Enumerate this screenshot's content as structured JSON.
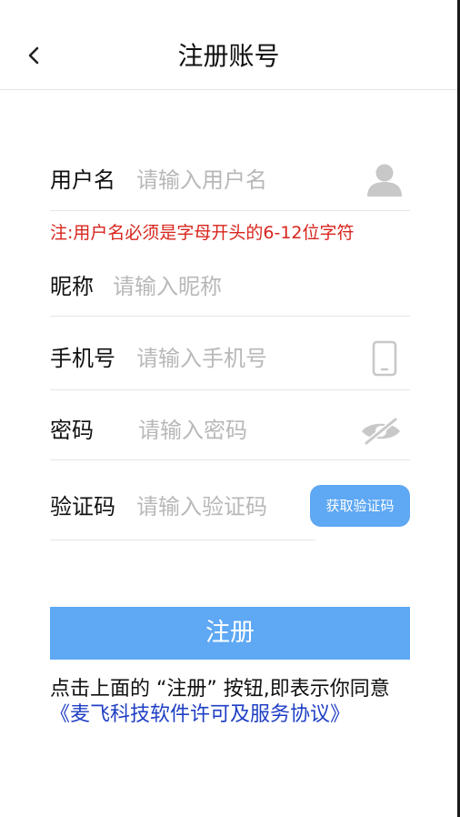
{
  "header": {
    "title": "注册账号",
    "back_icon": "chevron-left-icon"
  },
  "form": {
    "username": {
      "label": "用户名",
      "placeholder": "请输入用户名",
      "icon": "user-icon"
    },
    "username_hint": "注:用户名必须是字母开头的6-12位字符",
    "nickname": {
      "label": "昵称",
      "placeholder": "请输入昵称"
    },
    "phone": {
      "label": "手机号",
      "placeholder": "请输入手机号",
      "icon": "phone-icon"
    },
    "password": {
      "label": "密码",
      "placeholder": "请输入密码",
      "icon": "eye-off-icon"
    },
    "verification": {
      "label": "验证码",
      "placeholder": "请输入验证码",
      "button_label": "获取验证码"
    }
  },
  "submit_label": "注册",
  "agreement": {
    "text": "点击上面的 “注册” 按钮,即表示你同意",
    "link": "《麦飞科技软件许可及服务协议》"
  },
  "colors": {
    "primary": "#5ea8f4",
    "hint": "#d8251d",
    "link": "#1f3fc4",
    "placeholder": "#b8b8b8",
    "icon": "#c8c8c8"
  }
}
